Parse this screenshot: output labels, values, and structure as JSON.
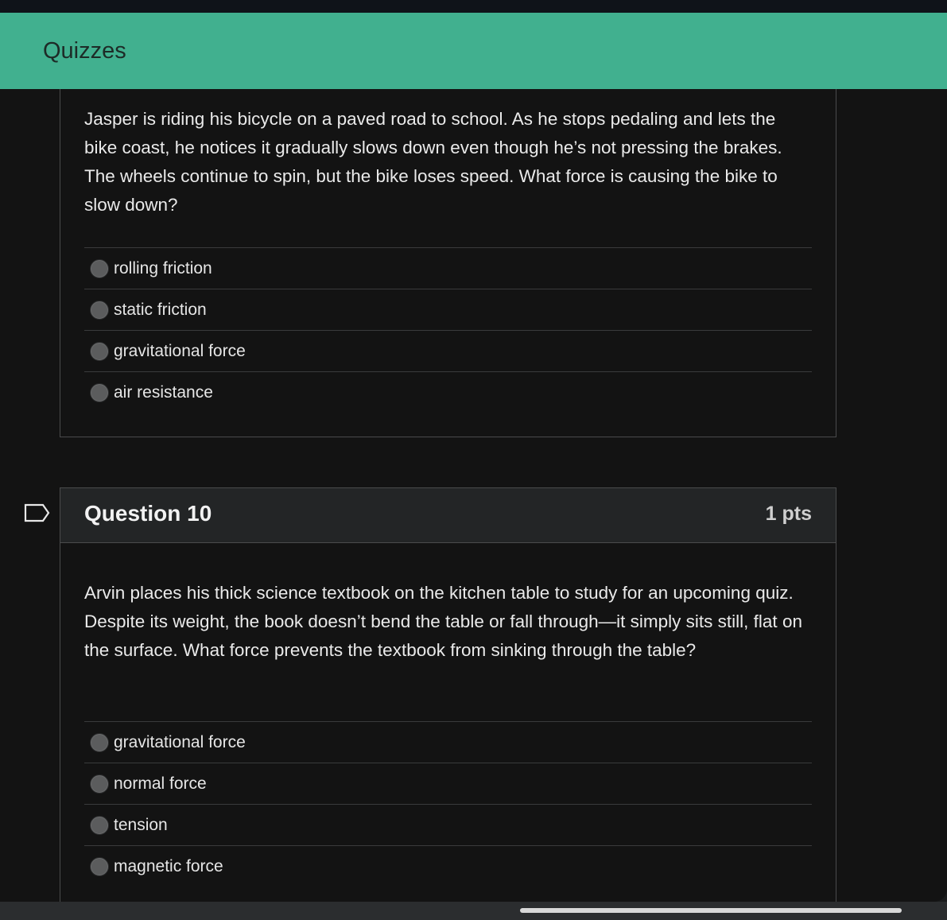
{
  "header": {
    "title": "Quizzes"
  },
  "previous_question": {
    "text": "Jasper is riding his bicycle on a paved road to school. As he stops pedaling and lets the bike coast, he notices it gradually slows down even though he’s not pressing the brakes. The wheels continue to spin, but the bike loses speed. What force is causing the bike to slow down?",
    "answers": [
      "rolling friction",
      "static friction",
      "gravitational force",
      "air resistance"
    ]
  },
  "question": {
    "title": "Question 10",
    "points": "1 pts",
    "text": "Arvin places his thick science textbook on the kitchen table to study for an upcoming quiz. Despite its weight, the book doesn’t bend the table or fall through—it simply sits still, flat on the surface. What force prevents the textbook from sinking through the table?",
    "answers": [
      "gravitational force",
      "normal force",
      "tension",
      "magnetic force"
    ]
  },
  "icons": {
    "flag": "flag-question-icon"
  },
  "colors": {
    "header": "#41b08f",
    "background": "#131313"
  }
}
